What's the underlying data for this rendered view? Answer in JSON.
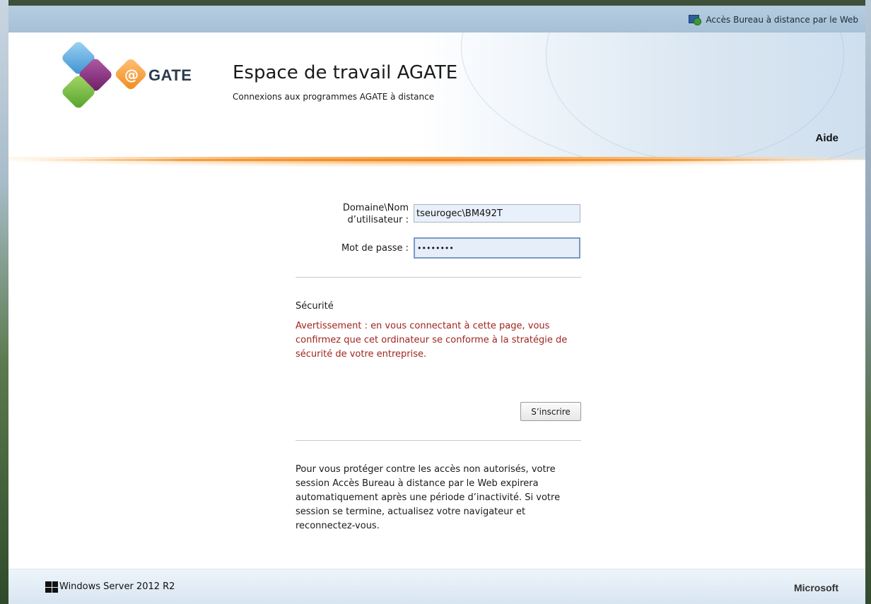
{
  "topbar": {
    "rd_web_link": "Accès Bureau à distance par le Web",
    "icon": "remote-desktop-icon"
  },
  "logo": {
    "at": "@",
    "text": "GATE"
  },
  "header": {
    "title": "Espace de travail AGATE",
    "subtitle": "Connexions aux programmes AGATE à distance",
    "help": "Aide"
  },
  "form": {
    "user_label_line1": "Domaine\\Nom",
    "user_label_line2": "d’utilisateur :",
    "user_value": "tseurogec\\BM492T",
    "pass_label": "Mot de passe :",
    "pass_value": "••••••••",
    "security_title": "Sécurité",
    "security_warning": "Avertissement : en vous connectant à cette page, vous confirmez que cet ordinateur se conforme à la stratégie de sécurité de votre entreprise.",
    "signin_button": "S’inscrire",
    "info_text": "Pour vous protéger contre les accès non autorisés, votre session Accès Bureau à distance par le Web expirera automatiquement après une période d’inactivité. Si votre session se termine, actualisez votre navigateur et reconnectez-vous."
  },
  "footer": {
    "os": "Windows Server 2012 R2",
    "brand": "Microsoft"
  },
  "colors": {
    "accent_orange": "#f08a1a",
    "warning_red": "#a0251f",
    "topbar_blue": "#a6c0d6"
  }
}
